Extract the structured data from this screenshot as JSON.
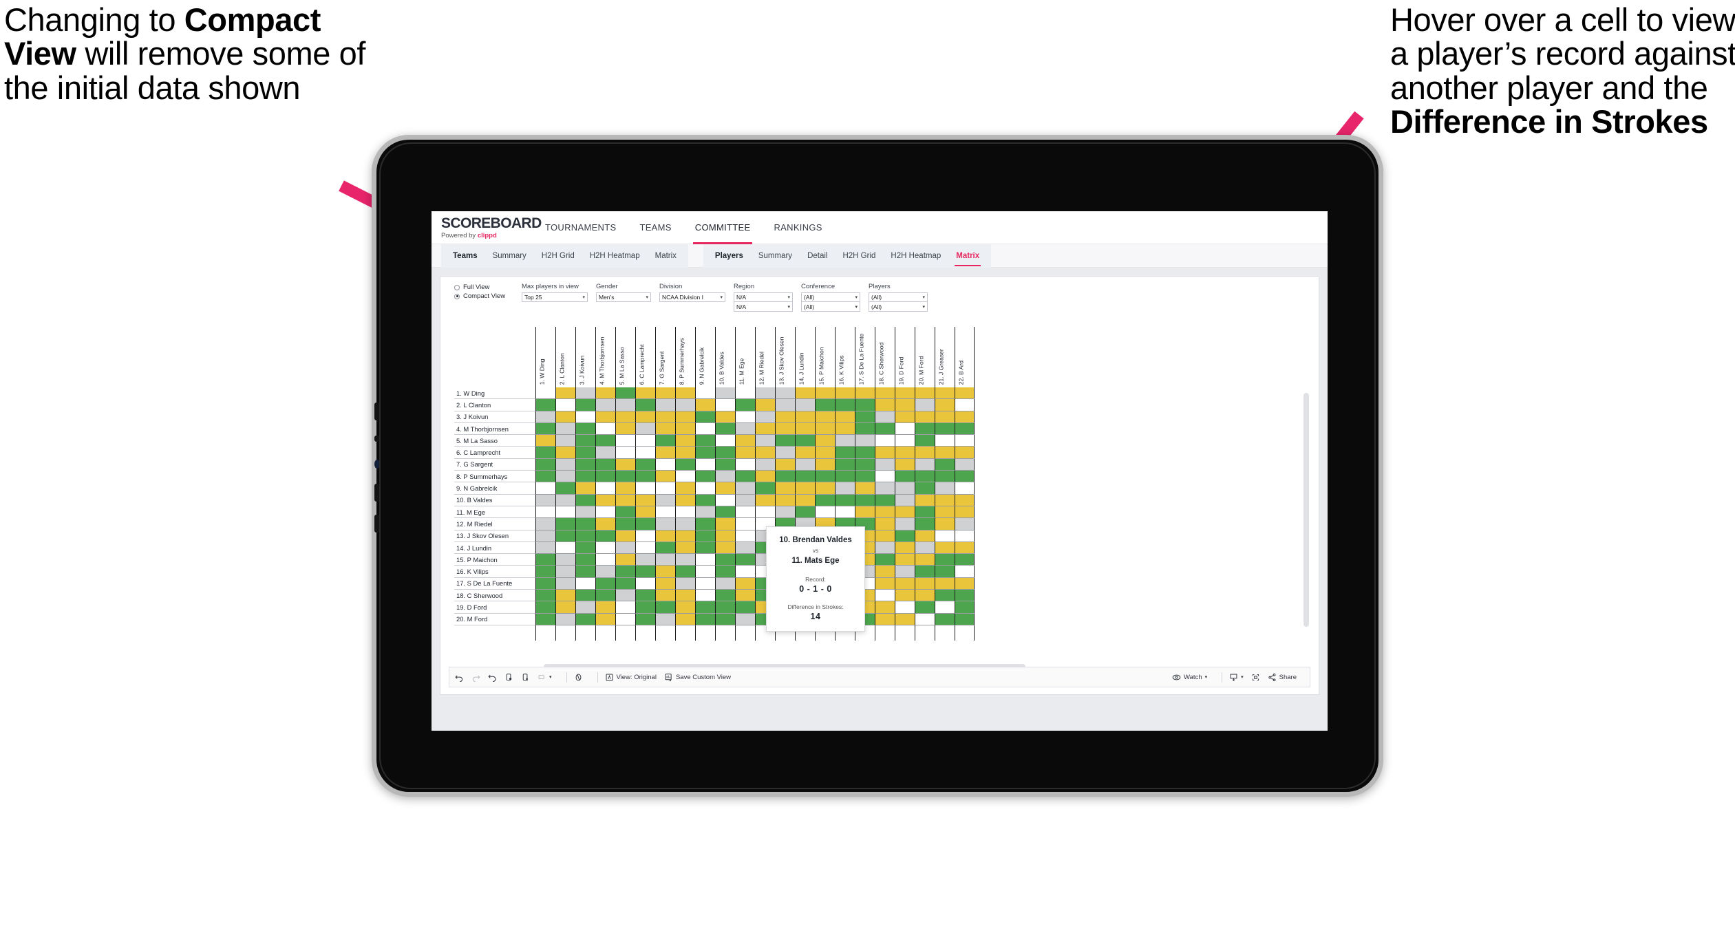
{
  "annotations": {
    "left": {
      "pre": "Changing to ",
      "bold": "Compact View",
      "post": " will remove some of the initial data shown"
    },
    "right": {
      "pre": "Hover over a cell to view a player’s record against another player and the ",
      "bold": "Difference in Strokes",
      "post": ""
    },
    "arrow_color": "#e8256b"
  },
  "brand": {
    "logo": "SCOREBOARD",
    "powered_prefix": "Powered by ",
    "powered_brand": "clippd",
    "accent": "#e6275f"
  },
  "topnav": [
    {
      "label": "TOURNAMENTS",
      "active": false
    },
    {
      "label": "TEAMS",
      "active": false
    },
    {
      "label": "COMMITTEE",
      "active": true
    },
    {
      "label": "RANKINGS",
      "active": false
    }
  ],
  "subnav": {
    "group1": [
      {
        "label": "Teams",
        "head": true,
        "active": false
      },
      {
        "label": "Summary",
        "head": false,
        "active": false
      },
      {
        "label": "H2H Grid",
        "head": false,
        "active": false
      },
      {
        "label": "H2H Heatmap",
        "head": false,
        "active": false
      },
      {
        "label": "Matrix",
        "head": false,
        "active": false
      }
    ],
    "group2": [
      {
        "label": "Players",
        "head": true,
        "active": false
      },
      {
        "label": "Summary",
        "head": false,
        "active": false
      },
      {
        "label": "Detail",
        "head": false,
        "active": false
      },
      {
        "label": "H2H Grid",
        "head": false,
        "active": false
      },
      {
        "label": "H2H Heatmap",
        "head": false,
        "active": false
      },
      {
        "label": "Matrix",
        "head": false,
        "active": true
      }
    ]
  },
  "filters": {
    "view_mode": {
      "full_label": "Full View",
      "compact_label": "Compact View",
      "selected": "Compact View"
    },
    "max_players": {
      "label": "Max players in view",
      "value": "Top 25"
    },
    "gender": {
      "label": "Gender",
      "value": "Men’s"
    },
    "division": {
      "label": "Division",
      "value": "NCAA Division I"
    },
    "region": {
      "label": "Region",
      "value": "N/A",
      "value2": "N/A"
    },
    "conference": {
      "label": "Conference",
      "value": "(All)",
      "value2": "(All)"
    },
    "players": {
      "label": "Players",
      "value": "(All)",
      "value2": "(All)"
    }
  },
  "matrix": {
    "columns": [
      "1. W Ding",
      "2. L Clanton",
      "3. J Koivun",
      "4. M Thorbjornsen",
      "5. M La Sasso",
      "6. C Lamprecht",
      "7. G Sargent",
      "8. P Summerhays",
      "9. N Gabrelcik",
      "10. B Valdes",
      "11. M Ege",
      "12. M Riedel",
      "13. J Skov Olesen",
      "14. J Lundin",
      "15. P Maichon",
      "16. K Vilips",
      "17. S De La Fuente",
      "18. C Sherwood",
      "19. D Ford",
      "20. M Ford",
      "21. J Greaser",
      "22. B Ard"
    ],
    "rows": [
      "1. W Ding",
      "2. L Clanton",
      "3. J Koivun",
      "4. M Thorbjornsen",
      "5. M La Sasso",
      "6. C Lamprecht",
      "7. G Sargent",
      "8. P Summerhays",
      "9. N Gabrelcik",
      "10. B Valdes",
      "11. M Ege",
      "12. M Riedel",
      "13. J Skov Olesen",
      "14. J Lundin",
      "15. P Maichon",
      "16. K Vilips",
      "17. S De La Fuente",
      "18. C Sherwood",
      "19. D Ford",
      "20. M Ford"
    ],
    "legend_colors": {
      "win": "#4da54d",
      "tie": "#e9c53c",
      "loss": "#cfd1d2",
      "none": "#ffffff"
    },
    "cells": [
      [
        "w",
        "y",
        "a",
        "y",
        "g",
        "y",
        "y",
        "y",
        "w",
        "a",
        "w",
        "a",
        "a",
        "y",
        "y",
        "y",
        "y",
        "y",
        "y",
        "y",
        "y",
        "y"
      ],
      [
        "g",
        "w",
        "g",
        "a",
        "a",
        "g",
        "a",
        "a",
        "y",
        "w",
        "g",
        "y",
        "a",
        "a",
        "g",
        "g",
        "g",
        "y",
        "y",
        "a",
        "y",
        "w"
      ],
      [
        "a",
        "y",
        "w",
        "y",
        "y",
        "y",
        "y",
        "y",
        "g",
        "y",
        "w",
        "a",
        "y",
        "y",
        "y",
        "y",
        "g",
        "a",
        "y",
        "y",
        "y",
        "y"
      ],
      [
        "g",
        "a",
        "g",
        "w",
        "y",
        "a",
        "y",
        "y",
        "w",
        "g",
        "a",
        "y",
        "y",
        "y",
        "y",
        "y",
        "g",
        "g",
        "w",
        "g",
        "g",
        "g"
      ],
      [
        "y",
        "a",
        "g",
        "g",
        "w",
        "w",
        "g",
        "y",
        "g",
        "w",
        "y",
        "a",
        "g",
        "g",
        "y",
        "a",
        "a",
        "w",
        "w",
        "g",
        "w",
        "w"
      ],
      [
        "g",
        "y",
        "g",
        "a",
        "w",
        "w",
        "y",
        "y",
        "g",
        "g",
        "y",
        "y",
        "a",
        "y",
        "y",
        "g",
        "g",
        "y",
        "y",
        "y",
        "y",
        "y"
      ],
      [
        "g",
        "a",
        "g",
        "g",
        "y",
        "g",
        "w",
        "g",
        "w",
        "g",
        "w",
        "a",
        "y",
        "a",
        "y",
        "g",
        "g",
        "a",
        "y",
        "a",
        "g",
        "a"
      ],
      [
        "g",
        "a",
        "g",
        "g",
        "g",
        "g",
        "y",
        "w",
        "g",
        "a",
        "g",
        "y",
        "g",
        "g",
        "g",
        "g",
        "g",
        "w",
        "g",
        "g",
        "g",
        "g"
      ],
      [
        "w",
        "g",
        "y",
        "w",
        "y",
        "w",
        "w",
        "y",
        "w",
        "y",
        "a",
        "g",
        "y",
        "y",
        "y",
        "a",
        "y",
        "a",
        "a",
        "g",
        "a",
        "w"
      ],
      [
        "a",
        "a",
        "g",
        "y",
        "y",
        "y",
        "a",
        "y",
        "g",
        "w",
        "a",
        "y",
        "y",
        "y",
        "g",
        "g",
        "g",
        "g",
        "a",
        "y",
        "y",
        "y"
      ],
      [
        "w",
        "w",
        "a",
        "w",
        "g",
        "y",
        "w",
        "w",
        "a",
        "g",
        "w",
        "w",
        "a",
        "g",
        "w",
        "w",
        "y",
        "y",
        "y",
        "g",
        "y",
        "y"
      ],
      [
        "a",
        "g",
        "g",
        "y",
        "g",
        "g",
        "a",
        "a",
        "g",
        "y",
        "w",
        "w",
        "g",
        "a",
        "y",
        "g",
        "g",
        "y",
        "a",
        "g",
        "y",
        "a"
      ],
      [
        "a",
        "g",
        "g",
        "g",
        "y",
        "w",
        "y",
        "y",
        "g",
        "y",
        "w",
        "a",
        "w",
        "g",
        "y",
        "y",
        "y",
        "y",
        "g",
        "y",
        "w",
        "w"
      ],
      [
        "a",
        "w",
        "g",
        "w",
        "a",
        "w",
        "g",
        "y",
        "g",
        "y",
        "a",
        "g",
        "a",
        "w",
        "y",
        "y",
        "y",
        "a",
        "y",
        "a",
        "y",
        "y"
      ],
      [
        "g",
        "a",
        "g",
        "w",
        "y",
        "a",
        "a",
        "a",
        "w",
        "g",
        "g",
        "a",
        "g",
        "g",
        "w",
        "g",
        "y",
        "g",
        "y",
        "y",
        "g",
        "g"
      ],
      [
        "g",
        "a",
        "g",
        "a",
        "g",
        "g",
        "y",
        "g",
        "w",
        "g",
        "w",
        "w",
        "g",
        "g",
        "a",
        "w",
        "a",
        "y",
        "a",
        "g",
        "g",
        "w"
      ],
      [
        "g",
        "a",
        "w",
        "g",
        "g",
        "w",
        "y",
        "a",
        "w",
        "a",
        "y",
        "g",
        "g",
        "y",
        "g",
        "a",
        "w",
        "y",
        "y",
        "y",
        "y",
        "y"
      ],
      [
        "g",
        "y",
        "g",
        "g",
        "a",
        "g",
        "y",
        "y",
        "w",
        "g",
        "y",
        "g",
        "y",
        "g",
        "a",
        "y",
        "y",
        "w",
        "y",
        "y",
        "g",
        "g"
      ],
      [
        "g",
        "y",
        "a",
        "y",
        "w",
        "g",
        "g",
        "y",
        "g",
        "g",
        "g",
        "y",
        "y",
        "y",
        "a",
        "g",
        "y",
        "y",
        "w",
        "g",
        "w",
        "g"
      ],
      [
        "g",
        "a",
        "g",
        "y",
        "w",
        "g",
        "a",
        "y",
        "g",
        "g",
        "a",
        "g",
        "g",
        "y",
        "w",
        "g",
        "g",
        "y",
        "y",
        "w",
        "g",
        "g"
      ]
    ]
  },
  "tooltip": {
    "player_a": "10. Brendan Valdes",
    "vs": "vs",
    "player_b": "11. Mats Ege",
    "record_label": "Record:",
    "record_value": "0 - 1 - 0",
    "strokes_label": "Difference in Strokes:",
    "strokes_value": "14"
  },
  "toolbar": {
    "view_original": "View: Original",
    "save_custom_view": "Save Custom View",
    "watch": "Watch",
    "share": "Share"
  }
}
